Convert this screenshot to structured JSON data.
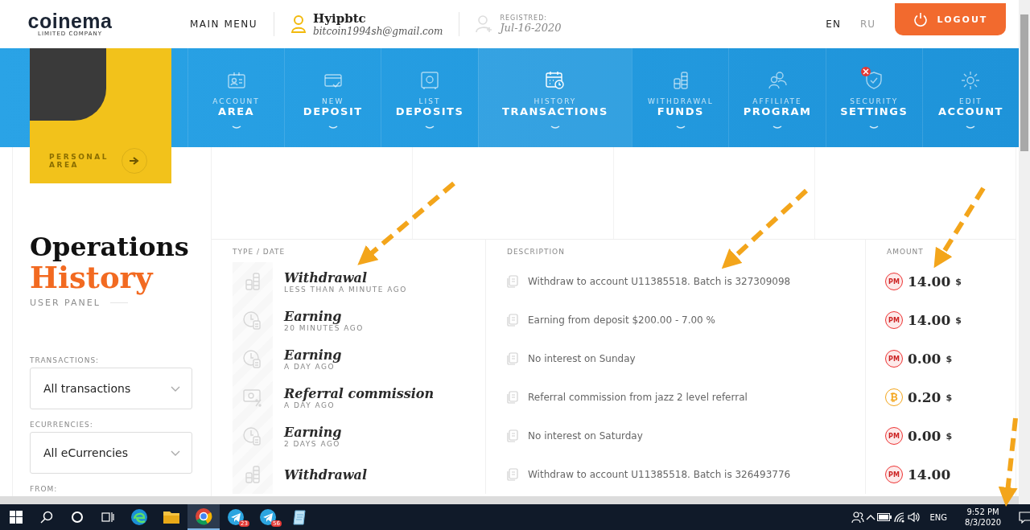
{
  "header": {
    "logo": {
      "name": "coinema",
      "tagline": "LIMITED COMPANY"
    },
    "main_menu": "MAIN MENU",
    "user": {
      "name": "Hyipbtc",
      "email": "bitcoin1994sh@gmail.com"
    },
    "registered": {
      "label": "REGISTRED:",
      "date": "Jul-16-2020"
    },
    "languages": [
      {
        "label": "EN",
        "selected": true
      },
      {
        "label": "RU",
        "selected": false
      }
    ],
    "logout": "LOGOUT"
  },
  "nav": [
    {
      "top": "ACCOUNT",
      "bottom": "AREA",
      "selected": false,
      "alert": false
    },
    {
      "top": "NEW",
      "bottom": "DEPOSIT",
      "selected": false,
      "alert": false
    },
    {
      "top": "LIST",
      "bottom": "DEPOSITS",
      "selected": false,
      "alert": false
    },
    {
      "top": "HISTORY",
      "bottom": "TRANSACTIONS",
      "selected": true,
      "alert": false
    },
    {
      "top": "WITHDRAWAL",
      "bottom": "FUNDS",
      "selected": false,
      "alert": false
    },
    {
      "top": "AFFILIATE",
      "bottom": "PROGRAM",
      "selected": false,
      "alert": false
    },
    {
      "top": "SECURITY",
      "bottom": "SETTINGS",
      "selected": false,
      "alert": true
    },
    {
      "top": "EDIT",
      "bottom": "ACCOUNT",
      "selected": false,
      "alert": false
    }
  ],
  "personal_area": "PERSONAL AREA",
  "page_title": {
    "line1": "Operations",
    "line2": "History",
    "subtitle": "USER PANEL"
  },
  "filters": [
    {
      "label": "TRANSACTIONS:",
      "value": "All transactions"
    },
    {
      "label": "ECURRENCIES:",
      "value": "All eCurrencies"
    },
    {
      "label": "FROM:"
    }
  ],
  "table": {
    "columns": [
      "TYPE / DATE",
      "DESCRIPTION",
      "AMOUNT"
    ],
    "rows": [
      {
        "kind": "withdrawal",
        "type": "Withdrawal",
        "date": "LESS THAN A MINUTE AGO",
        "description": "Withdraw to account U11385518. Batch is 327309098",
        "currency": {
          "kind": "pm",
          "label": "PM"
        },
        "amount": "14.00",
        "unit": "$"
      },
      {
        "kind": "earning",
        "type": "Earning",
        "date": "20 MINUTES AGO",
        "description": "Earning from deposit $200.00 - 7.00 %",
        "currency": {
          "kind": "pm",
          "label": "PM"
        },
        "amount": "14.00",
        "unit": "$"
      },
      {
        "kind": "earning",
        "type": "Earning",
        "date": "A DAY AGO",
        "description": "No interest on Sunday",
        "currency": {
          "kind": "pm",
          "label": "PM"
        },
        "amount": "0.00",
        "unit": "$"
      },
      {
        "kind": "referral",
        "type": "Referral commission",
        "date": "A DAY AGO",
        "description": "Referral commission from jazz 2 level referral",
        "currency": {
          "kind": "btc",
          "label": "₿"
        },
        "amount": "0.20",
        "unit": "$"
      },
      {
        "kind": "earning",
        "type": "Earning",
        "date": "2 DAYS AGO",
        "description": "No interest on Saturday",
        "currency": {
          "kind": "pm",
          "label": "PM"
        },
        "amount": "0.00",
        "unit": "$"
      },
      {
        "kind": "withdrawal",
        "type": "Withdrawal",
        "description": "Withdraw to account U11385518. Batch is 326493776",
        "currency": {
          "kind": "pm",
          "label": "PM"
        },
        "amount": "14.00"
      }
    ]
  },
  "taskbar": {
    "apps": [
      {
        "kind": "edge",
        "selected": false
      },
      {
        "kind": "folder",
        "selected": false
      },
      {
        "kind": "chrome",
        "selected": true
      },
      {
        "kind": "telegram",
        "badge": "23",
        "selected": false
      },
      {
        "kind": "telegram",
        "badge": "56",
        "selected": false
      },
      {
        "kind": "notepad",
        "selected": false
      }
    ],
    "language": "ENG",
    "time": "9:52 PM",
    "date": "8/3/2020"
  }
}
